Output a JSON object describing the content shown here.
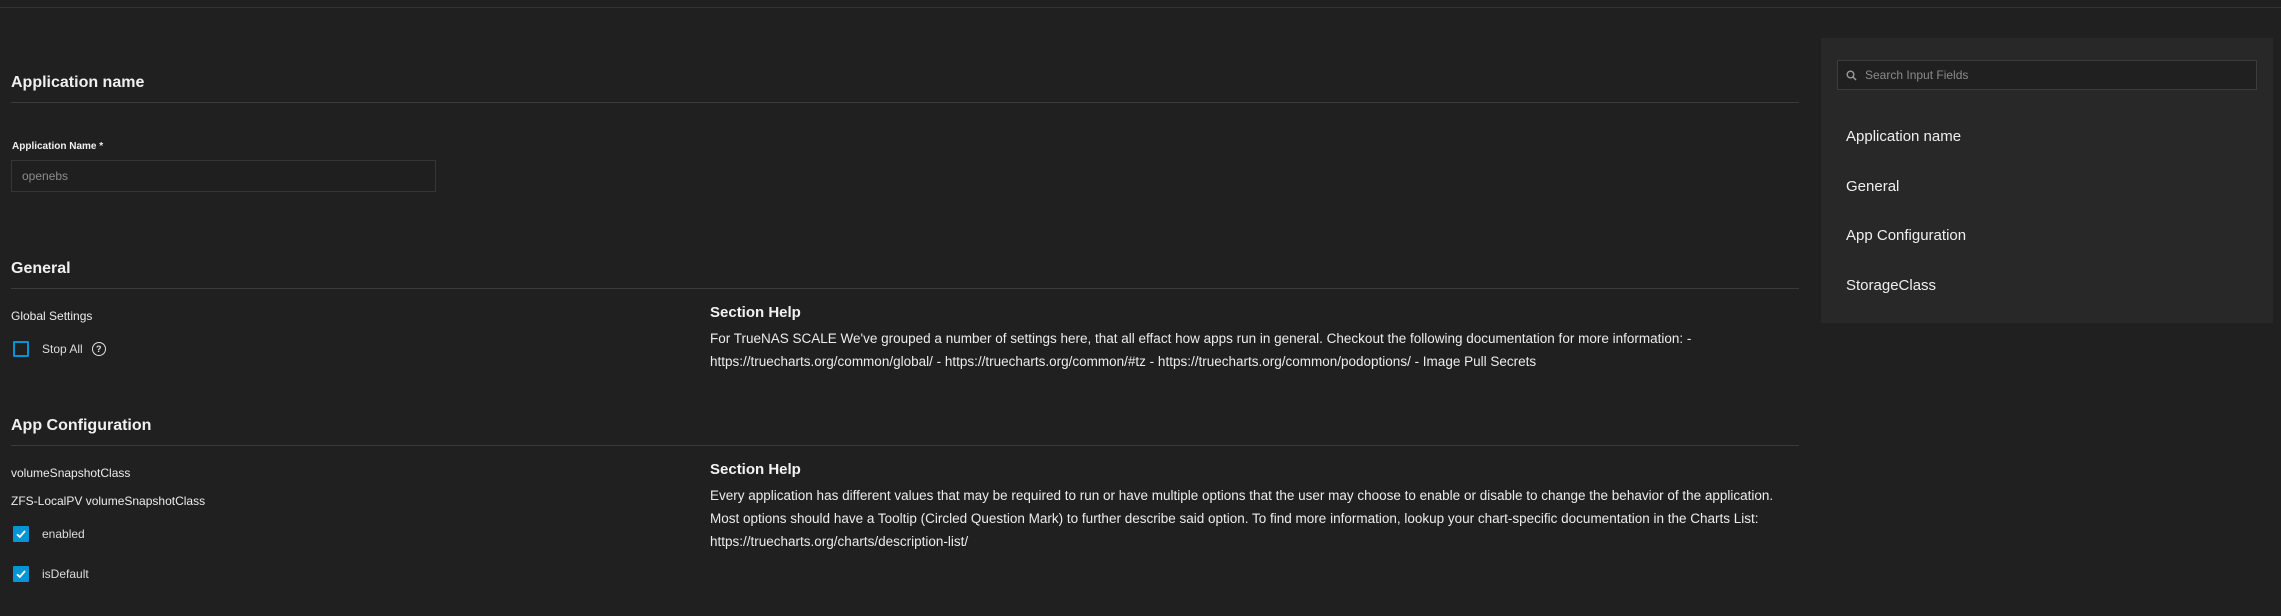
{
  "sections": {
    "application_name": {
      "title": "Application name",
      "field_label": "Application Name *",
      "input_value": "openebs"
    },
    "general": {
      "title": "General",
      "group_label": "Global Settings",
      "stop_all": {
        "label": "Stop All",
        "checked": false
      },
      "help_title": "Section Help",
      "help_text": "For TrueNAS SCALE We've grouped a number of settings here, that all effact how apps run in general. Checkout the following documentation for more information: - https://truecharts.org/common/global/ - https://truecharts.org/common/#tz - https://truecharts.org/common/podoptions/ - Image Pull Secrets"
    },
    "app_configuration": {
      "title": "App Configuration",
      "group_label": "volumeSnapshotClass",
      "sub_group_label": "ZFS-LocalPV volumeSnapshotClass",
      "enabled": {
        "label": "enabled",
        "checked": true
      },
      "is_default": {
        "label": "isDefault",
        "checked": true
      },
      "help_title": "Section Help",
      "help_text": "Every application has different values that may be required to run or have multiple options that the user may choose to enable or disable to change the behavior of the application. Most options should have a Tooltip (Circled Question Mark) to further describe said option. To find more information, lookup your chart-specific documentation in the Charts List: https://truecharts.org/charts/description-list/"
    }
  },
  "sidebar": {
    "search_placeholder": "Search Input Fields",
    "items": [
      {
        "label": "Application name"
      },
      {
        "label": "General"
      },
      {
        "label": "App Configuration"
      },
      {
        "label": "StorageClass"
      }
    ]
  },
  "icons": {
    "help": "question-circle-icon",
    "search": "search-icon",
    "check": "check-icon"
  },
  "colors": {
    "accent": "#0095d5",
    "background": "#202020",
    "panel": "#282828"
  }
}
